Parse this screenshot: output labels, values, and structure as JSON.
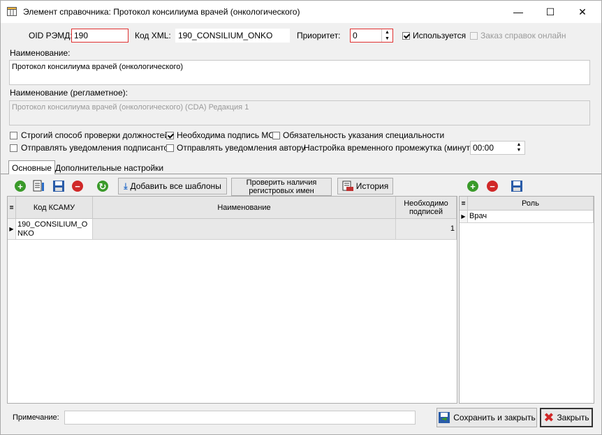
{
  "window": {
    "title": "Элемент справочника: Протокол консилиума врачей (онкологического)",
    "minimize": "—",
    "maximize": "☐",
    "close": "✕"
  },
  "fields": {
    "oid_label": "OID РЭМД:",
    "oid_value": "190",
    "xml_label": "Код XML:",
    "xml_value": "190_CONSILIUM_ONKO",
    "priority_label": "Приоритет:",
    "priority_value": "0",
    "used_label": "Используется",
    "used_checked": true,
    "order_label": "Заказ справок онлайн",
    "order_checked": false,
    "name_label": "Наименование:",
    "name_value": "Протокол консилиума врачей (онкологического)",
    "reg_name_label": "Наименование (регламетное):",
    "reg_name_value": "Протокол консилиума врачей (онкологического) (CDA) Редакция 1"
  },
  "options": [
    {
      "label": "Строгий способ проверки должностей",
      "checked": false
    },
    {
      "label": "Необходима подпись МО",
      "checked": true
    },
    {
      "label": "Обязательность указания специальности",
      "checked": false
    },
    {
      "label": "Отправлять уведомления подписантов",
      "checked": false
    },
    {
      "label": "Отправлять уведомления автору",
      "checked": false
    }
  ],
  "time_label": "Настройка временного промежутка (минуты):",
  "time_value": "00:00",
  "tabs": [
    "Основные",
    "Дополнительные настройки"
  ],
  "toolbar": {
    "add_all": "Добавить все шаблоны",
    "check_reg": "Проверить наличия регистровых имен",
    "history": "История"
  },
  "main_grid": {
    "columns": [
      "Код КСАМУ",
      "Наименование",
      "Необходимо подписей"
    ],
    "rows": [
      {
        "code": "190_CONSILIUM_ONKO",
        "name": "",
        "signs": "1"
      }
    ]
  },
  "role_grid": {
    "columns": [
      "Роль"
    ],
    "rows": [
      "Врач"
    ]
  },
  "footer": {
    "note_label": "Примечание:",
    "note_value": "",
    "save_close": "Сохранить и закрыть",
    "close": "Закрыть"
  }
}
